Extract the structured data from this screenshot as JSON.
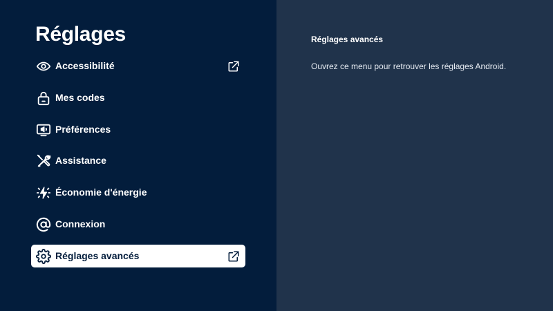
{
  "page": {
    "title": "Réglages"
  },
  "menu": {
    "items": [
      {
        "label": "Accessibilité",
        "icon": "eye-icon",
        "external": true,
        "selected": false
      },
      {
        "label": "Mes codes",
        "icon": "lock-icon",
        "external": false,
        "selected": false
      },
      {
        "label": "Préférences",
        "icon": "tv-sound-icon",
        "external": false,
        "selected": false
      },
      {
        "label": "Assistance",
        "icon": "tools-icon",
        "external": false,
        "selected": false
      },
      {
        "label": "Économie d'énergie",
        "icon": "energy-icon",
        "external": false,
        "selected": false
      },
      {
        "label": "Connexion",
        "icon": "at-icon",
        "external": false,
        "selected": false
      },
      {
        "label": "Réglages avancés",
        "icon": "gear-icon",
        "external": true,
        "selected": true
      }
    ]
  },
  "detail": {
    "title": "Réglages avancés",
    "description": "Ouvrez ce menu pour retrouver les réglages Android."
  },
  "colors": {
    "left_panel": "#031d3c",
    "right_panel": "#20334b",
    "selected_bg": "#ffffff",
    "text": "#ffffff"
  }
}
